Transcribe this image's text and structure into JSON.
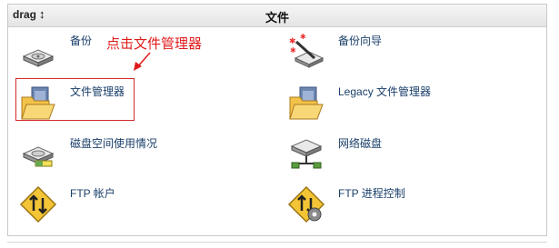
{
  "header": {
    "drag_label": "drag",
    "title": "文件"
  },
  "items": [
    {
      "label": "备份",
      "icon": "backup-disk-icon"
    },
    {
      "label": "备份向导",
      "icon": "backup-wizard-icon"
    },
    {
      "label": "文件管理器",
      "icon": "file-manager-folder-icon"
    },
    {
      "label": "Legacy 文件管理器",
      "icon": "legacy-file-manager-folder-icon"
    },
    {
      "label": "磁盘空间使用情况",
      "icon": "disk-usage-icon"
    },
    {
      "label": "网络磁盘",
      "icon": "network-disk-icon"
    },
    {
      "label": "FTP 帐户",
      "icon": "ftp-accounts-icon"
    },
    {
      "label": "FTP 进程控制",
      "icon": "ftp-session-control-icon"
    }
  ],
  "annotation": {
    "text": "点击文件管理器",
    "color": "#e01b1b"
  },
  "colors": {
    "link": "#1a3f6a",
    "highlight_border": "#d22a2a"
  }
}
